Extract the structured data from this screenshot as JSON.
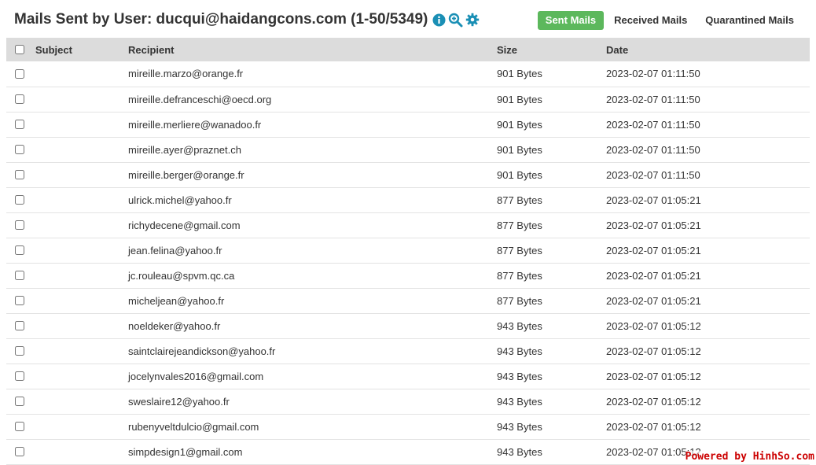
{
  "header": {
    "title": "Mails Sent by User: ducqui@haidangcons.com (1-50/5349)",
    "icons": [
      "info-icon",
      "zoom-in-icon",
      "gear-icon"
    ],
    "tabs": [
      {
        "label": "Sent Mails",
        "active": true
      },
      {
        "label": "Received Mails",
        "active": false
      },
      {
        "label": "Quarantined Mails",
        "active": false
      }
    ]
  },
  "table": {
    "columns": [
      "Subject",
      "Recipient",
      "Size",
      "Date"
    ],
    "rows": [
      {
        "subject": "",
        "recipient": "mireille.marzo@orange.fr",
        "size": "901 Bytes",
        "date": "2023-02-07 01:11:50"
      },
      {
        "subject": "",
        "recipient": "mireille.defranceschi@oecd.org",
        "size": "901 Bytes",
        "date": "2023-02-07 01:11:50"
      },
      {
        "subject": "",
        "recipient": "mireille.merliere@wanadoo.fr",
        "size": "901 Bytes",
        "date": "2023-02-07 01:11:50"
      },
      {
        "subject": "",
        "recipient": "mireille.ayer@praznet.ch",
        "size": "901 Bytes",
        "date": "2023-02-07 01:11:50"
      },
      {
        "subject": "",
        "recipient": "mireille.berger@orange.fr",
        "size": "901 Bytes",
        "date": "2023-02-07 01:11:50"
      },
      {
        "subject": "",
        "recipient": "ulrick.michel@yahoo.fr",
        "size": "877 Bytes",
        "date": "2023-02-07 01:05:21"
      },
      {
        "subject": "",
        "recipient": "richydecene@gmail.com",
        "size": "877 Bytes",
        "date": "2023-02-07 01:05:21"
      },
      {
        "subject": "",
        "recipient": "jean.felina@yahoo.fr",
        "size": "877 Bytes",
        "date": "2023-02-07 01:05:21"
      },
      {
        "subject": "",
        "recipient": "jc.rouleau@spvm.qc.ca",
        "size": "877 Bytes",
        "date": "2023-02-07 01:05:21"
      },
      {
        "subject": "",
        "recipient": "micheljean@yahoo.fr",
        "size": "877 Bytes",
        "date": "2023-02-07 01:05:21"
      },
      {
        "subject": "",
        "recipient": "noeldeker@yahoo.fr",
        "size": "943 Bytes",
        "date": "2023-02-07 01:05:12"
      },
      {
        "subject": "",
        "recipient": "saintclairejeandickson@yahoo.fr",
        "size": "943 Bytes",
        "date": "2023-02-07 01:05:12"
      },
      {
        "subject": "",
        "recipient": "jocelynvales2016@gmail.com",
        "size": "943 Bytes",
        "date": "2023-02-07 01:05:12"
      },
      {
        "subject": "",
        "recipient": "sweslaire12@yahoo.fr",
        "size": "943 Bytes",
        "date": "2023-02-07 01:05:12"
      },
      {
        "subject": "",
        "recipient": "rubenyveltdulcio@gmail.com",
        "size": "943 Bytes",
        "date": "2023-02-07 01:05:12"
      },
      {
        "subject": "",
        "recipient": "simpdesign1@gmail.com",
        "size": "943 Bytes",
        "date": "2023-02-07 01:05:12"
      }
    ]
  },
  "watermark": "Powered by HinhSo.com",
  "colors": {
    "accent_green": "#5cb85c",
    "icon_teal": "#1a8fb5",
    "header_bg": "#dcdcdc"
  }
}
